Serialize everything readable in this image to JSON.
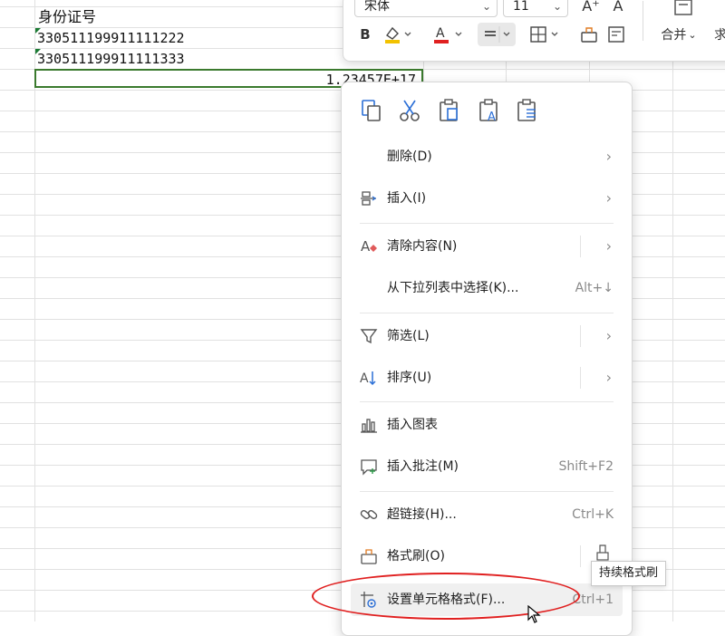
{
  "sheet": {
    "header_cell": "身份证号",
    "rows": [
      "330511199911111222",
      "330511199911111333"
    ],
    "active_cell_value": "1.23457E+17"
  },
  "mini_toolbar": {
    "font_name": "宋体",
    "font_size": "11",
    "grow_font": "A⁺",
    "shrink_font": "A",
    "bold": "B",
    "merge_label": "合并",
    "overflow_label": "求",
    "fill_color": "#f2c200",
    "font_color": "#e02020"
  },
  "context_menu": {
    "quick_actions": [
      "copy-icon",
      "cut-icon",
      "paste-icon",
      "paste-values-icon",
      "paste-text-icon"
    ],
    "items": [
      {
        "label": "删除(D)",
        "shortcut": "",
        "has_submenu": true,
        "icon": "none"
      },
      {
        "label": "插入(I)",
        "shortcut": "",
        "has_submenu": true,
        "icon": "insert-icon"
      },
      {
        "label": "清除内容(N)",
        "shortcut": "",
        "has_submenu": true,
        "icon": "clear-content-icon"
      },
      {
        "label": "从下拉列表中选择(K)...",
        "shortcut": "Alt+↓",
        "has_submenu": false,
        "icon": "none"
      },
      {
        "label": "筛选(L)",
        "shortcut": "",
        "has_submenu": true,
        "icon": "filter-icon"
      },
      {
        "label": "排序(U)",
        "shortcut": "",
        "has_submenu": true,
        "icon": "sort-icon"
      },
      {
        "label": "插入图表",
        "shortcut": "",
        "has_submenu": false,
        "icon": "chart-icon"
      },
      {
        "label": "插入批注(M)",
        "shortcut": "Shift+F2",
        "has_submenu": false,
        "icon": "comment-icon"
      },
      {
        "label": "超链接(H)...",
        "shortcut": "Ctrl+K",
        "has_submenu": false,
        "icon": "link-icon"
      },
      {
        "label": "格式刷(O)",
        "shortcut": "",
        "has_submenu": false,
        "icon": "format-painter-icon"
      },
      {
        "label": "设置单元格格式(F)...",
        "shortcut": "Ctrl+1",
        "has_submenu": false,
        "icon": "format-cells-icon"
      }
    ]
  },
  "tooltip": "持续格式刷",
  "colors": {
    "accent_green": "#3b7a2e",
    "annotation_red": "#e02020",
    "icon_blue": "#2b6fd6"
  }
}
